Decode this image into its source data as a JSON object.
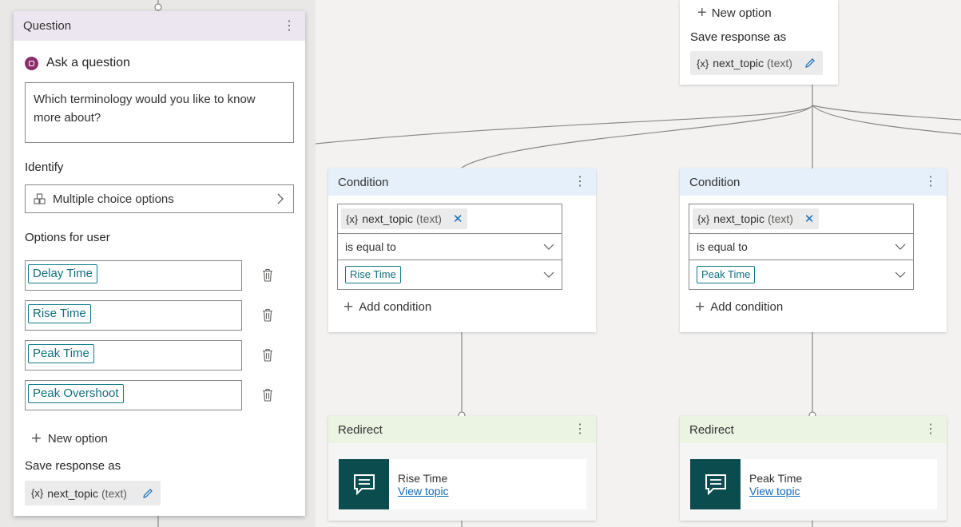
{
  "question_card": {
    "header": "Question",
    "ask_title": "Ask a question",
    "question_text": "Which terminology would you like to know more about?",
    "identify_label": "Identify",
    "identify_value": "Multiple choice options",
    "options_label": "Options for user",
    "options": [
      {
        "label": "Delay Time"
      },
      {
        "label": "Rise Time"
      },
      {
        "label": "Peak Time"
      },
      {
        "label": "Peak Overshoot"
      }
    ],
    "new_option": "New option",
    "save_label": "Save response as",
    "variable_icon": "{x}",
    "variable_name": "next_topic",
    "variable_type": "(text)"
  },
  "top_partial_card": {
    "new_option": "New option",
    "save_label": "Save response as",
    "variable_icon": "{x}",
    "variable_name": "next_topic",
    "variable_type": "(text)"
  },
  "conditions": [
    {
      "header": "Condition",
      "variable_icon": "{x}",
      "variable_name": "next_topic",
      "variable_type": "(text)",
      "operator": "is equal to",
      "value": "Rise Time",
      "add_condition": "Add condition"
    },
    {
      "header": "Condition",
      "variable_icon": "{x}",
      "variable_name": "next_topic",
      "variable_type": "(text)",
      "operator": "is equal to",
      "value": "Peak Time",
      "add_condition": "Add condition"
    }
  ],
  "redirects": [
    {
      "header": "Redirect",
      "topic": "Rise Time",
      "link": "View topic"
    },
    {
      "header": "Redirect",
      "topic": "Peak Time",
      "link": "View topic"
    }
  ],
  "colors": {
    "question_header": "#ece6f1",
    "condition_header": "#e5f0fb",
    "redirect_header": "#ebf4e3",
    "redirect_icon_bg": "#0b4d4f",
    "tag_border": "#0f7b8a",
    "ask_icon": "#8c2d6c"
  }
}
